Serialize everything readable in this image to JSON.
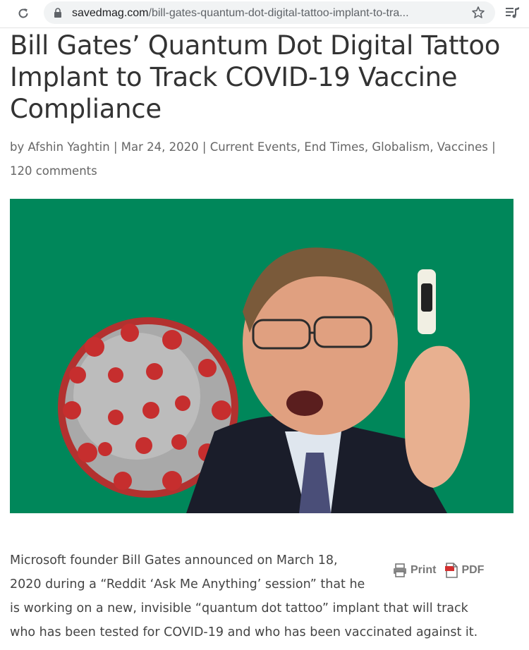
{
  "browser": {
    "url_host": "savedmag.com",
    "url_path": "/bill-gates-quantum-dot-digital-tattoo-implant-to-tra..."
  },
  "article": {
    "title": "Bill Gates’ Quantum Dot Digital Tattoo Implant to Track COVID-19 Vaccine Compliance",
    "author_prefix": "by",
    "author": "Afshin Yaghtin",
    "date": "Mar 24, 2020",
    "categories": [
      "Current Events",
      "End Times",
      "Globalism",
      "Vaccines"
    ],
    "comments": "120 comments",
    "hero_image_alt": "",
    "print_label": "Print",
    "pdf_label": "PDF",
    "body_lines": [
      "Microsoft founder Bill Gates announced on March 18,",
      "2020 during a “Reddit ‘Ask Me Anything’ session” that he",
      "is working on a new, invisible “quantum dot tattoo” implant that will track",
      "who has been tested for COVID-19 and who has been vaccinated against it."
    ]
  },
  "colors": {
    "hero_background": "#00875a",
    "title_text": "#333333",
    "meta_text": "#666666"
  }
}
